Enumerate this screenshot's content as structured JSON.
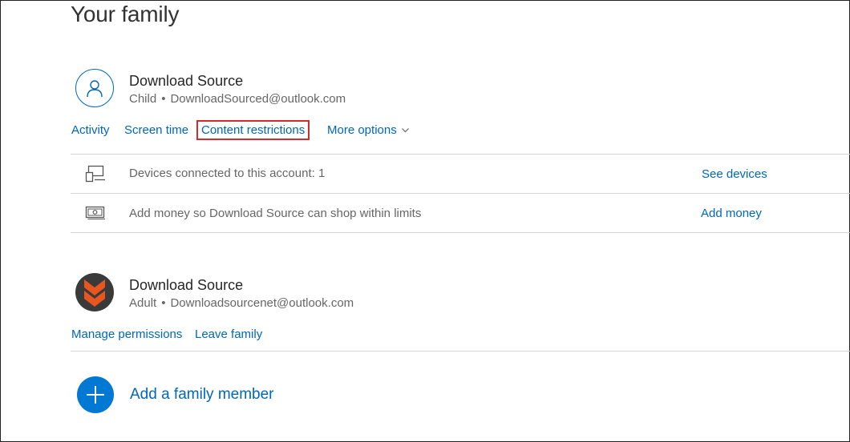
{
  "page": {
    "title": "Your family"
  },
  "member_child": {
    "name": "Download Source",
    "role": "Child",
    "separator": "•",
    "email": "DownloadSourced@outlook.com",
    "actions": {
      "activity": "Activity",
      "screen_time": "Screen time",
      "content_restrictions": "Content restrictions",
      "more_options": "More options"
    },
    "rows": [
      {
        "icon": "devices-icon",
        "text": "Devices connected to this account: 1",
        "action": "See devices"
      },
      {
        "icon": "money-icon",
        "text": "Add money so Download Source can shop within limits",
        "action": "Add money"
      }
    ]
  },
  "member_adult": {
    "name": "Download Source",
    "role": "Adult",
    "separator": "•",
    "email": "Downloadsourcenet@outlook.com",
    "actions": {
      "manage_permissions": "Manage permissions",
      "leave_family": "Leave family"
    }
  },
  "add_member": {
    "label": "Add a family member",
    "icon": "plus-icon"
  },
  "colors": {
    "link": "#0067b8",
    "accent": "#0078d4",
    "highlight": "#d62b2b",
    "logo_orange": "#e8561f"
  }
}
